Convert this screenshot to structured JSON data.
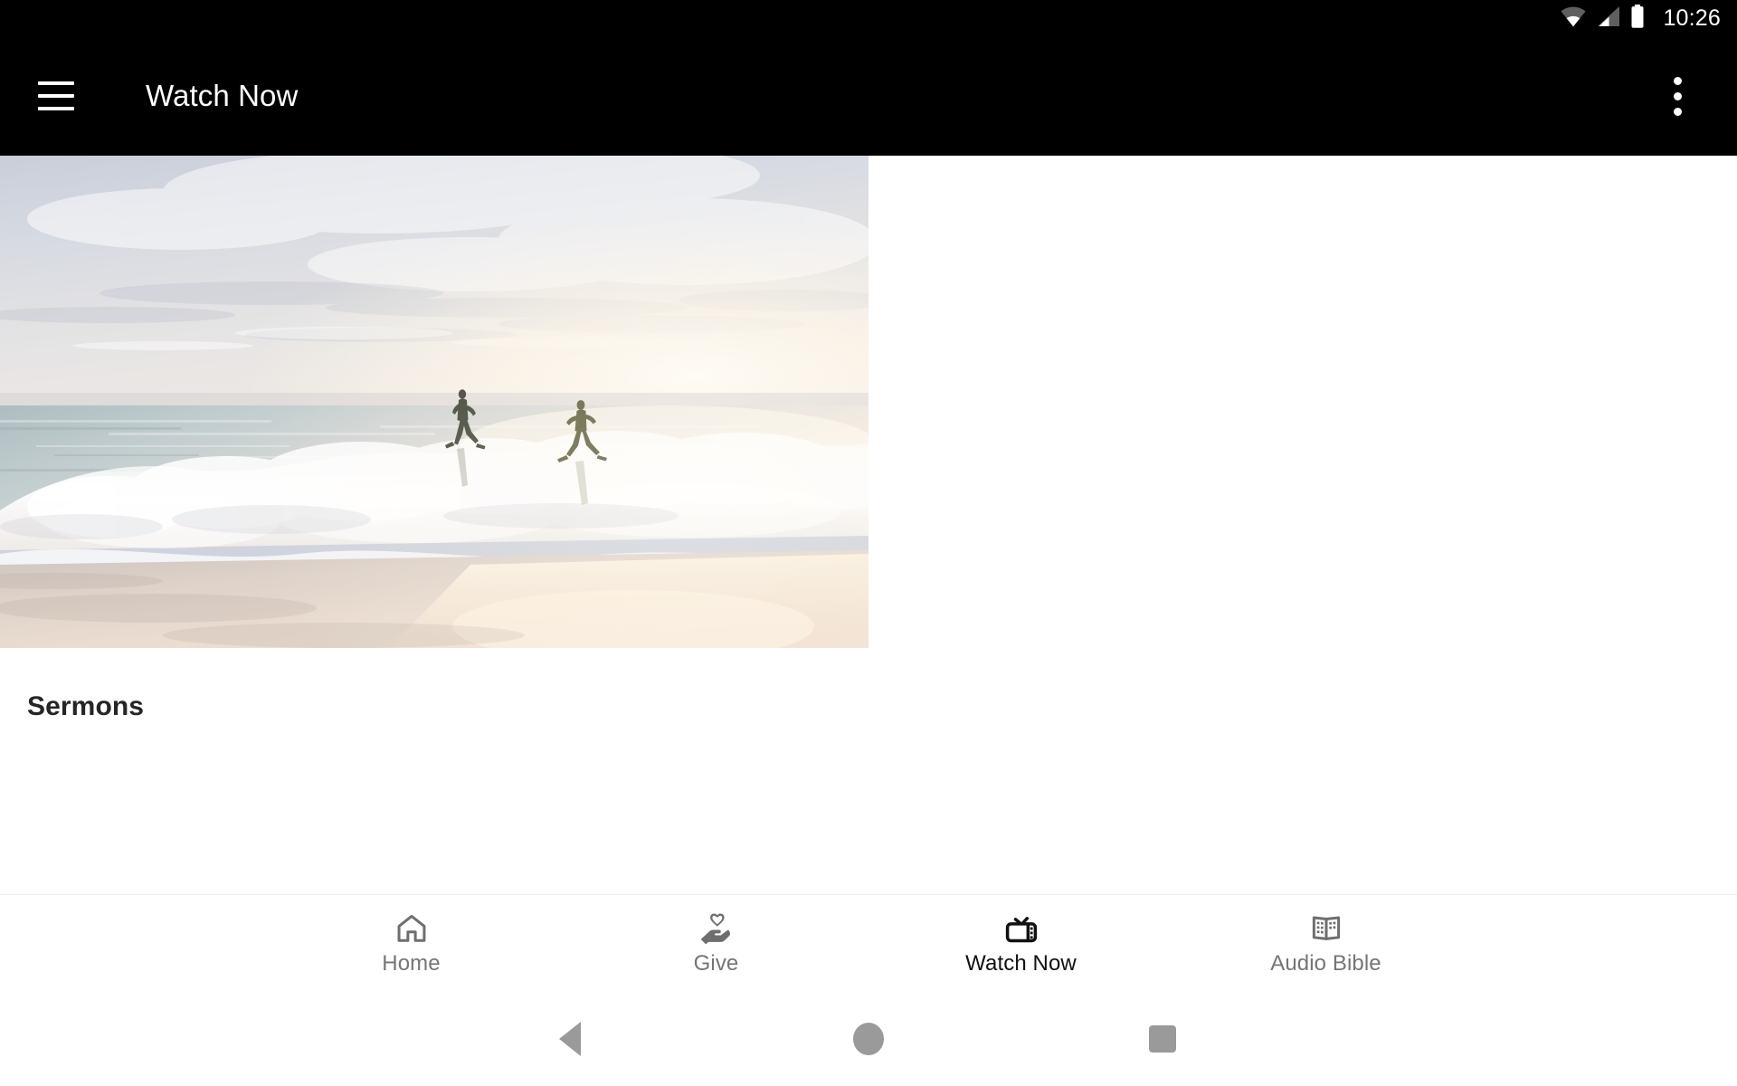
{
  "status_bar": {
    "time": "10:26",
    "icons": [
      "wifi-icon",
      "cellular-signal-icon",
      "battery-icon"
    ]
  },
  "app_bar": {
    "menu_icon": "hamburger-menu-icon",
    "title": "Watch Now",
    "overflow_icon": "more-vert-icon",
    "background_color": "#000000",
    "text_color": "#ffffff"
  },
  "main": {
    "cards": [
      {
        "title": "Sermons",
        "thumbnail_alt": "beach-sunrise-runners-photo"
      }
    ]
  },
  "bottom_nav": {
    "active_index": 2,
    "active_color": "#111111",
    "inactive_color": "#757575",
    "items": [
      {
        "label": "Home",
        "icon": "home-icon"
      },
      {
        "label": "Give",
        "icon": "volunteer-activism-icon"
      },
      {
        "label": "Watch Now",
        "icon": "tv-icon"
      },
      {
        "label": "Audio Bible",
        "icon": "menu-book-icon"
      }
    ]
  },
  "system_nav": {
    "back": "back-triangle-icon",
    "home": "home-circle-icon",
    "recents": "recents-square-icon",
    "color": "#9a9a9a"
  }
}
